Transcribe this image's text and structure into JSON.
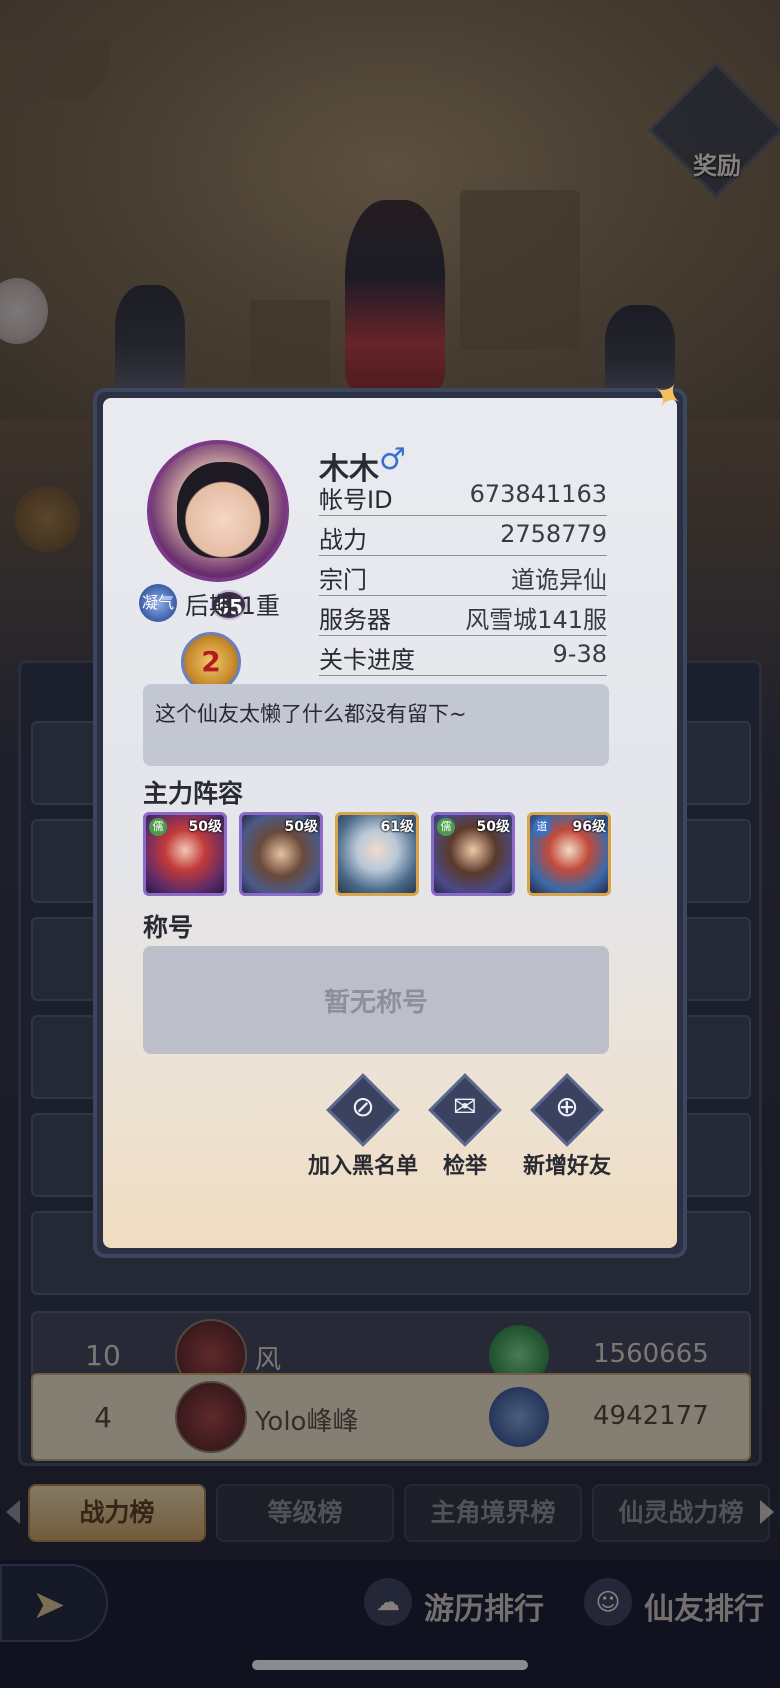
{
  "background": {
    "reward_label": "奖励"
  },
  "ranking": {
    "rows": [
      {
        "rank": "10",
        "name": "风",
        "power": "1560665"
      }
    ],
    "self_row": {
      "rank": "4",
      "name": "Yolo峰峰",
      "power": "4942177"
    }
  },
  "tabs": [
    {
      "label": "战力榜",
      "active": true
    },
    {
      "label": "等级榜",
      "active": false
    },
    {
      "label": "主角境界榜",
      "active": false
    },
    {
      "label": "仙灵战力榜",
      "active": false
    }
  ],
  "bottom_nav": {
    "items": [
      {
        "label": "游历排行",
        "icon": "travel-icon"
      },
      {
        "label": "仙友排行",
        "icon": "friends-icon"
      }
    ]
  },
  "profile": {
    "name": "木木",
    "gender_symbol": "♂",
    "level": "65",
    "realm_icon_text": "凝气",
    "realm": "后期.1重",
    "rank_emblem_number": "2",
    "fields": [
      {
        "label": "帐号ID",
        "value": "673841163"
      },
      {
        "label": "战力",
        "value": "2758779"
      },
      {
        "label": "宗门",
        "value": "道诡异仙"
      },
      {
        "label": "服务器",
        "value": "风雪城141服"
      },
      {
        "label": "关卡进度",
        "value": "9-38"
      }
    ],
    "motto": "这个仙友太懒了什么都没有留下~",
    "lineup_title": "主力阵容",
    "lineup": [
      {
        "tag": "儒",
        "level": "50级",
        "frame": "purple"
      },
      {
        "tag": "",
        "level": "50级",
        "frame": "purple"
      },
      {
        "tag": "",
        "level": "61级",
        "frame": "gold"
      },
      {
        "tag": "儒",
        "level": "50级",
        "frame": "purple"
      },
      {
        "tag": "道",
        "level": "96级",
        "frame": "gold"
      }
    ],
    "title_header": "称号",
    "title_empty": "暂无称号",
    "actions": [
      {
        "label": "加入黑名单",
        "icon": "block-icon",
        "glyph": "⊘"
      },
      {
        "label": "检举",
        "icon": "mail-icon",
        "glyph": "✉"
      },
      {
        "label": "新增好友",
        "icon": "add-friend-icon",
        "glyph": "⊕"
      }
    ]
  },
  "colors": {
    "modal_bg": "#e9ebf0",
    "accent_gold": "#c99e5c",
    "gender_blue": "#3a6fd0"
  }
}
